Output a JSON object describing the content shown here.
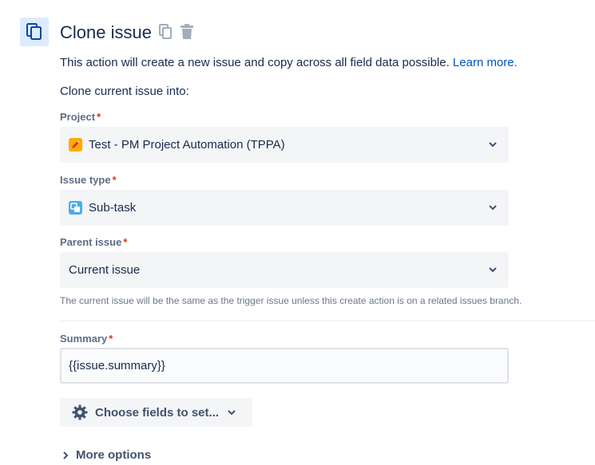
{
  "header": {
    "title": "Clone issue"
  },
  "description": {
    "text": "This action will create a new issue and copy across all field data possible.",
    "link": "Learn more."
  },
  "subheading": "Clone current issue into:",
  "fields": {
    "project": {
      "label": "Project",
      "required": "*",
      "value": "Test - PM Project Automation (TPPA)"
    },
    "issue_type": {
      "label": "Issue type",
      "required": "*",
      "value": "Sub-task"
    },
    "parent_issue": {
      "label": "Parent issue",
      "required": "*",
      "value": "Current issue",
      "helper": "The current issue will be the same as the trigger issue unless this create action is on a related issues branch."
    },
    "summary": {
      "label": "Summary",
      "required": "*",
      "value": "{{issue.summary}}"
    }
  },
  "buttons": {
    "choose_fields": "Choose fields to set...",
    "more_options": "More options"
  },
  "colors": {
    "accent": "#0052cc",
    "required": "#de350b",
    "icon_bg": "#deebff"
  }
}
